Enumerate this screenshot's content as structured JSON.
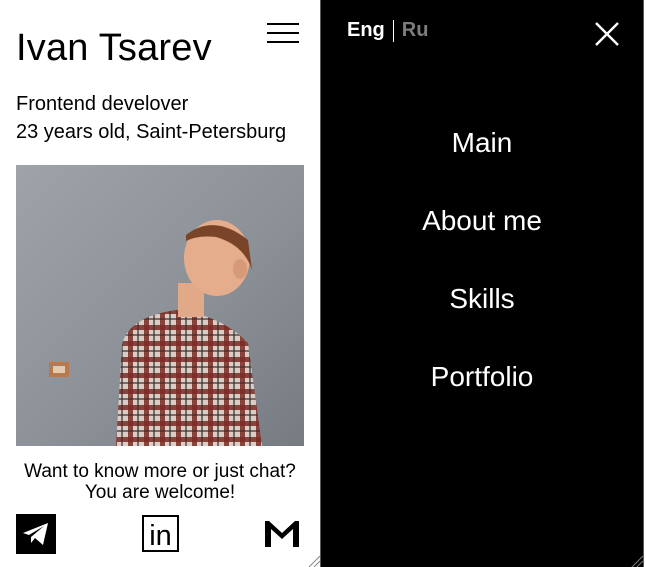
{
  "profile": {
    "name": "Ivan Tsarev",
    "role": "Frontend develover",
    "age_location": "23 years old, Saint-Petersburg",
    "cta_line1": "Want to know more or just chat?",
    "cta_line2": "You are welcome!"
  },
  "icons": {
    "menu": "hamburger-icon",
    "close": "close-icon",
    "social": [
      "telegram-icon",
      "linkedin-icon",
      "gmail-icon"
    ],
    "linkedin_text": "in"
  },
  "menu": {
    "languages": {
      "active": "Eng",
      "inactive": "Ru"
    },
    "items": [
      "Main",
      "About me",
      "Skills",
      "Portfolio"
    ]
  },
  "colors": {
    "menu_background": "#000000",
    "menu_text": "#ffffff",
    "inactive_language": "#7d7d7d",
    "page_background": "#ffffff"
  }
}
